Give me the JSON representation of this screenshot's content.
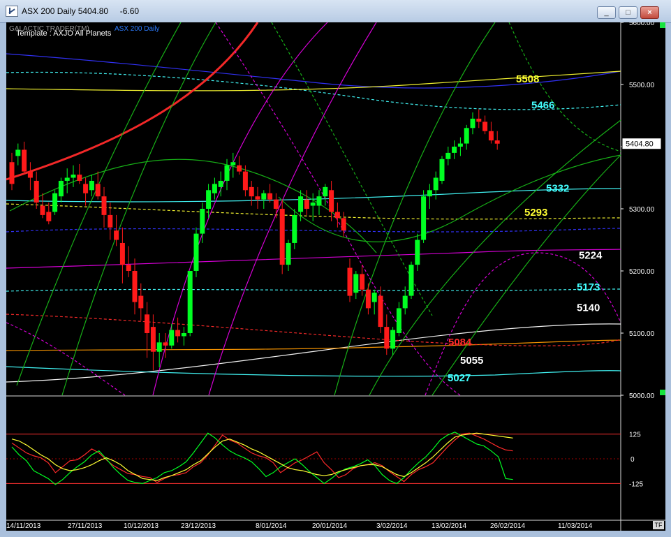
{
  "window": {
    "title": "ASX 200 Daily 5404.80     -6.60",
    "minimize": "_",
    "maximize": "□",
    "close": "×"
  },
  "chart_header": {
    "brand": "GALACTIC TRADER(TM)",
    "series": "ASX 200 Daily",
    "template": "Template : AXJO All Planets"
  },
  "colors": {
    "background": "#000000",
    "up": "#00ff22",
    "down": "#ff1a1a",
    "yellow": "#ffff33",
    "cyan": "#44ffff",
    "white": "#ffffff",
    "orange": "#ff9900",
    "magenta": "#e000e0",
    "blue": "#3333ff",
    "green": "#18b818",
    "red": "#ff2a2a"
  },
  "chart_data": {
    "type": "candlestick",
    "price_axis": {
      "ticks": [
        "5600.00",
        "5500.00",
        "5400.00",
        "5300.00",
        "5200.00",
        "5100.00",
        "5000.00"
      ],
      "ylim": [
        5000,
        5600
      ],
      "current_label": "5404.80"
    },
    "oscillator_axis": {
      "ticks": [
        "125",
        "0",
        "-125"
      ]
    },
    "x_labels": [
      "14/11/2013",
      "27/11/2013",
      "10/12/2013",
      "23/12/2013",
      "8/01/2014",
      "20/01/2014",
      "3/02/2014",
      "13/02/2014",
      "26/02/2014",
      "11/03/2014"
    ],
    "level_labels": [
      {
        "value": "5508",
        "color": "#ffff33"
      },
      {
        "value": "5466",
        "color": "#44ffff"
      },
      {
        "value": "5332",
        "color": "#44ffff"
      },
      {
        "value": "5293",
        "color": "#ffff33"
      },
      {
        "value": "5224",
        "color": "#ffffff"
      },
      {
        "value": "5173",
        "color": "#44ffff"
      },
      {
        "value": "5140",
        "color": "#ffffff"
      },
      {
        "value": "5084",
        "color": "#ff2a2a"
      },
      {
        "value": "5055",
        "color": "#ffffff"
      },
      {
        "value": "5027",
        "color": "#44ffff"
      }
    ],
    "candles": [
      [
        5375,
        5390,
        5330,
        5340
      ],
      [
        5385,
        5405,
        5370,
        5395
      ],
      [
        5395,
        5408,
        5355,
        5360
      ],
      [
        5360,
        5375,
        5330,
        5350
      ],
      [
        5345,
        5360,
        5300,
        5310
      ],
      [
        5305,
        5325,
        5285,
        5290
      ],
      [
        5295,
        5310,
        5275,
        5280
      ],
      [
        5295,
        5330,
        5290,
        5325
      ],
      [
        5320,
        5350,
        5310,
        5345
      ],
      [
        5345,
        5365,
        5325,
        5350
      ],
      [
        5350,
        5370,
        5335,
        5355
      ],
      [
        5355,
        5372,
        5340,
        5345
      ],
      [
        5340,
        5350,
        5305,
        5325
      ],
      [
        5330,
        5355,
        5320,
        5345
      ],
      [
        5340,
        5360,
        5315,
        5320
      ],
      [
        5320,
        5335,
        5270,
        5290
      ],
      [
        5290,
        5310,
        5250,
        5270
      ],
      [
        5265,
        5290,
        5240,
        5250
      ],
      [
        5245,
        5270,
        5180,
        5210
      ],
      [
        5210,
        5240,
        5190,
        5200
      ],
      [
        5200,
        5220,
        5130,
        5150
      ],
      [
        5160,
        5180,
        5120,
        5140
      ],
      [
        5130,
        5150,
        5060,
        5100
      ],
      [
        5110,
        5130,
        5040,
        5070
      ],
      [
        5070,
        5100,
        5045,
        5085
      ],
      [
        5085,
        5100,
        5060,
        5080
      ],
      [
        5080,
        5115,
        5075,
        5105
      ],
      [
        5105,
        5125,
        5085,
        5095
      ],
      [
        5095,
        5110,
        5080,
        5100
      ],
      [
        5100,
        5200,
        5095,
        5200
      ],
      [
        5200,
        5270,
        5190,
        5260
      ],
      [
        5260,
        5310,
        5245,
        5300
      ],
      [
        5300,
        5340,
        5285,
        5330
      ],
      [
        5325,
        5350,
        5315,
        5340
      ],
      [
        5335,
        5360,
        5320,
        5345
      ],
      [
        5345,
        5380,
        5330,
        5370
      ],
      [
        5370,
        5390,
        5350,
        5375
      ],
      [
        5370,
        5385,
        5355,
        5360
      ],
      [
        5360,
        5370,
        5320,
        5330
      ],
      [
        5335,
        5345,
        5305,
        5320
      ],
      [
        5320,
        5335,
        5300,
        5315
      ],
      [
        5315,
        5330,
        5300,
        5325
      ],
      [
        5325,
        5340,
        5310,
        5315
      ],
      [
        5315,
        5325,
        5285,
        5300
      ],
      [
        5300,
        5315,
        5195,
        5210
      ],
      [
        5210,
        5250,
        5200,
        5245
      ],
      [
        5245,
        5300,
        5235,
        5290
      ],
      [
        5295,
        5330,
        5280,
        5320
      ],
      [
        5315,
        5330,
        5290,
        5300
      ],
      [
        5305,
        5325,
        5280,
        5310
      ],
      [
        5305,
        5330,
        5290,
        5320
      ],
      [
        5320,
        5340,
        5305,
        5335
      ],
      [
        5330,
        5345,
        5280,
        5295
      ],
      [
        5295,
        5310,
        5270,
        5285
      ],
      [
        5285,
        5295,
        5255,
        5265
      ],
      [
        5205,
        5220,
        5150,
        5160
      ],
      [
        5165,
        5200,
        5155,
        5195
      ],
      [
        5195,
        5210,
        5160,
        5170
      ],
      [
        5170,
        5180,
        5130,
        5140
      ],
      [
        5150,
        5170,
        5130,
        5165
      ],
      [
        5160,
        5175,
        5100,
        5110
      ],
      [
        5110,
        5130,
        5065,
        5075
      ],
      [
        5075,
        5110,
        5065,
        5105
      ],
      [
        5100,
        5150,
        5095,
        5140
      ],
      [
        5140,
        5175,
        5130,
        5160
      ],
      [
        5160,
        5215,
        5155,
        5210
      ],
      [
        5210,
        5260,
        5200,
        5250
      ],
      [
        5250,
        5330,
        5245,
        5320
      ],
      [
        5320,
        5340,
        5300,
        5330
      ],
      [
        5330,
        5360,
        5315,
        5350
      ],
      [
        5345,
        5385,
        5340,
        5380
      ],
      [
        5380,
        5400,
        5370,
        5390
      ],
      [
        5390,
        5410,
        5380,
        5400
      ],
      [
        5400,
        5415,
        5385,
        5405
      ],
      [
        5405,
        5435,
        5395,
        5430
      ],
      [
        5430,
        5455,
        5420,
        5445
      ],
      [
        5445,
        5460,
        5430,
        5440
      ],
      [
        5440,
        5450,
        5420,
        5425
      ],
      [
        5425,
        5440,
        5405,
        5410
      ],
      [
        5410,
        5425,
        5395,
        5404.8
      ]
    ],
    "oscillators": {
      "red": [
        80,
        55,
        30,
        15,
        5,
        -20,
        -70,
        -40,
        -10,
        -5,
        20,
        50,
        30,
        -5,
        -35,
        -55,
        -75,
        -80,
        -90,
        -95,
        -120,
        -100,
        -85,
        -80,
        -70,
        -40,
        -20,
        20,
        70,
        120,
        95,
        80,
        55,
        30,
        15,
        5,
        -20,
        -70,
        -45,
        -20,
        -5,
        15,
        35,
        -20,
        -55,
        -95,
        -80,
        -50,
        -35,
        -30,
        -20,
        -35,
        -65,
        -90,
        -115,
        -80,
        -55,
        -40,
        -20,
        20,
        60,
        95,
        125,
        130,
        115,
        100,
        80,
        60,
        45,
        40
      ],
      "green": [
        60,
        20,
        -10,
        -60,
        -80,
        -100,
        -130,
        -105,
        -70,
        -40,
        -15,
        20,
        40,
        0,
        -45,
        -80,
        -110,
        -120,
        -125,
        -110,
        -95,
        -70,
        -60,
        -40,
        -15,
        30,
        80,
        130,
        105,
        70,
        40,
        20,
        5,
        -15,
        -50,
        -90,
        -70,
        -40,
        -20,
        0,
        -30,
        -65,
        -95,
        -125,
        -100,
        -70,
        -50,
        -40,
        -25,
        -5,
        -35,
        -80,
        -110,
        -125,
        -95,
        -55,
        -20,
        10,
        50,
        95,
        120,
        135,
        115,
        95,
        75,
        65,
        40,
        10,
        -100,
        -105
      ],
      "yellow": [
        100,
        90,
        70,
        45,
        20,
        0,
        -30,
        -50,
        -60,
        -55,
        -45,
        -30,
        -10,
        5,
        -10,
        -30,
        -60,
        -80,
        -100,
        -105,
        -110,
        -95,
        -85,
        -70,
        -55,
        -30,
        -10,
        25,
        60,
        90,
        100,
        85,
        70,
        50,
        35,
        15,
        -5,
        -25,
        -45,
        -55,
        -60,
        -70,
        -80,
        -85,
        -80,
        -65,
        -55,
        -45,
        -35,
        -30,
        -30,
        -40,
        -60,
        -80,
        -90,
        -70,
        -45,
        -20,
        10,
        45,
        80,
        110,
        120,
        125,
        130,
        125,
        120,
        115,
        110,
        105
      ]
    }
  }
}
